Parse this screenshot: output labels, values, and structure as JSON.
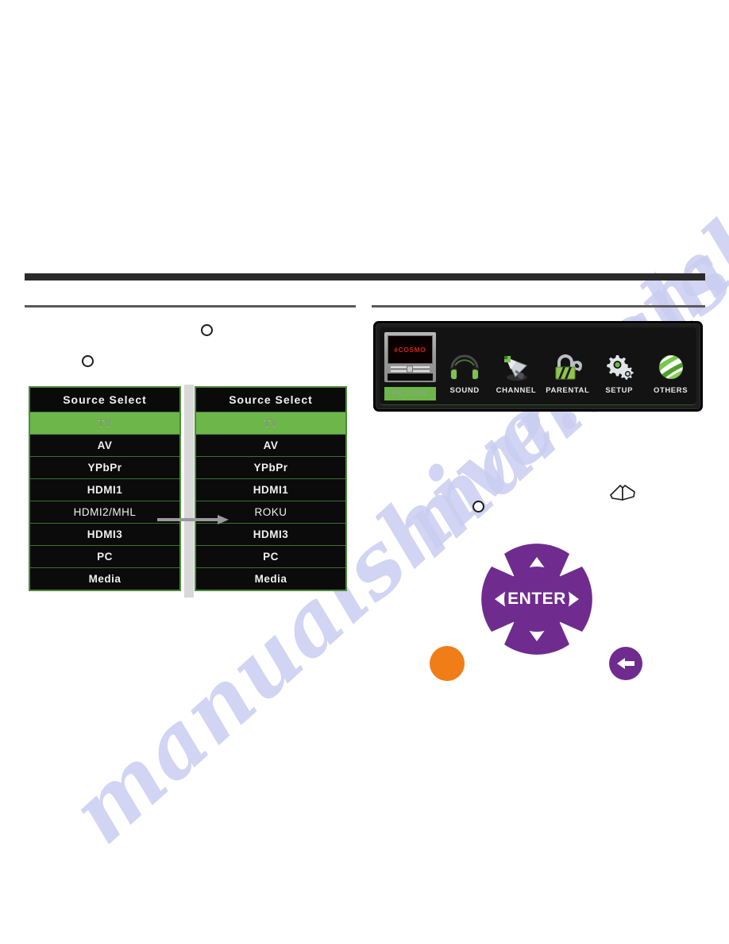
{
  "watermark": {
    "text_primary": "manualshive.com",
    "text_secondary": "manualshive.com",
    "color": "#c9cdf0"
  },
  "callouts": {
    "marker_1": "",
    "marker_2": "",
    "marker_3": ""
  },
  "source_menus": {
    "before": {
      "title": "Source Select",
      "selected_index": 0,
      "items": [
        {
          "label": "TV",
          "selected": true
        },
        {
          "label": "AV",
          "selected": false
        },
        {
          "label": "YPbPr",
          "selected": false
        },
        {
          "label": "HDMI1",
          "selected": false
        },
        {
          "label": "HDMI2/MHL",
          "selected": false
        },
        {
          "label": "HDMI3",
          "selected": false
        },
        {
          "label": "PC",
          "selected": false
        },
        {
          "label": "Media",
          "selected": false
        }
      ]
    },
    "after": {
      "title": "Source Select",
      "selected_index": 0,
      "items": [
        {
          "label": "TV",
          "selected": true
        },
        {
          "label": "AV",
          "selected": false
        },
        {
          "label": "YPbPr",
          "selected": false
        },
        {
          "label": "HDMI1",
          "selected": false
        },
        {
          "label": "ROKU",
          "selected": false
        },
        {
          "label": "HDMI3",
          "selected": false
        },
        {
          "label": "PC",
          "selected": false
        },
        {
          "label": "Media",
          "selected": false
        }
      ]
    },
    "highlight_color": "#6cb64a",
    "border_color": "#4e8a3c",
    "connector_icon": "right-arrow-icon"
  },
  "osd_menubar": {
    "items": [
      {
        "label": "PICTURE",
        "icon": "tv-picture-icon",
        "active": true
      },
      {
        "label": "SOUND",
        "icon": "headphones-icon",
        "active": false
      },
      {
        "label": "CHANNEL",
        "icon": "satellite-dish-icon",
        "active": false
      },
      {
        "label": "PARENTAL",
        "icon": "padlock-icon",
        "active": false
      },
      {
        "label": "SETUP",
        "icon": "gears-icon",
        "active": false
      },
      {
        "label": "OTHERS",
        "icon": "globe-icon",
        "active": false
      }
    ],
    "brand_on_screen": "éCOSMO",
    "brand_color": "#d4231c",
    "active_color": "#6cb64a"
  },
  "remote": {
    "enter_label": "ENTER",
    "buttons": [
      {
        "name": "up-arrow",
        "icon": "triangle-up-icon"
      },
      {
        "name": "down-arrow",
        "icon": "triangle-down-icon"
      },
      {
        "name": "left-arrow",
        "icon": "triangle-left-icon"
      },
      {
        "name": "right-arrow",
        "icon": "triangle-right-icon"
      },
      {
        "name": "enter",
        "icon": "enter-icon"
      },
      {
        "name": "back",
        "icon": "back-arrow-icon"
      },
      {
        "name": "source",
        "icon": "orange-round-button-icon"
      }
    ],
    "dpad_color": "#6f2b8e",
    "orange_button_color": "#f07d17",
    "note_icon": "open-book-icon"
  }
}
